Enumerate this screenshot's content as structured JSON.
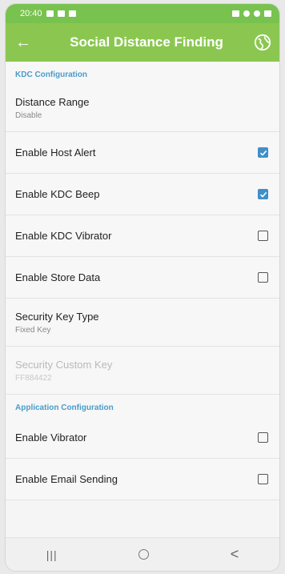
{
  "status_bar": {
    "time": "20:40",
    "left_icons": [
      "gallery-icon",
      "cloud-icon",
      "bag-icon"
    ],
    "right_icons": [
      "signal-icon",
      "wifi-icon",
      "dnd-icon",
      "battery-icon"
    ]
  },
  "app_bar": {
    "back_icon": "back-arrow-icon",
    "title": "Social Distance Finding",
    "action_icon": "globe-icon"
  },
  "colors": {
    "app_bar": "#8bc750",
    "status_bar": "#78c24f",
    "section_header": "#4a9cc8",
    "checkbox_checked": "#3f8fc8"
  },
  "sections": [
    {
      "header": "KDC Configuration",
      "items": [
        {
          "title": "Distance Range",
          "summary": "Disable"
        },
        {
          "title": "Enable Host Alert",
          "checked": true
        },
        {
          "title": "Enable KDC Beep",
          "checked": true
        },
        {
          "title": "Enable KDC Vibrator",
          "checked": false
        },
        {
          "title": "Enable Store Data",
          "checked": false
        },
        {
          "title": "Security Key Type",
          "summary": "Fixed Key"
        },
        {
          "title": "Security Custom Key",
          "summary": "FF884422",
          "enabled": false
        }
      ]
    },
    {
      "header": "Application Configuration",
      "items": [
        {
          "title": "Enable Vibrator",
          "checked": false
        },
        {
          "title": "Enable Email Sending",
          "checked": false
        }
      ]
    }
  ],
  "nav_bar": {
    "recents_glyph": "|||",
    "home_icon": "home-circle-icon",
    "back_glyph": "<"
  }
}
